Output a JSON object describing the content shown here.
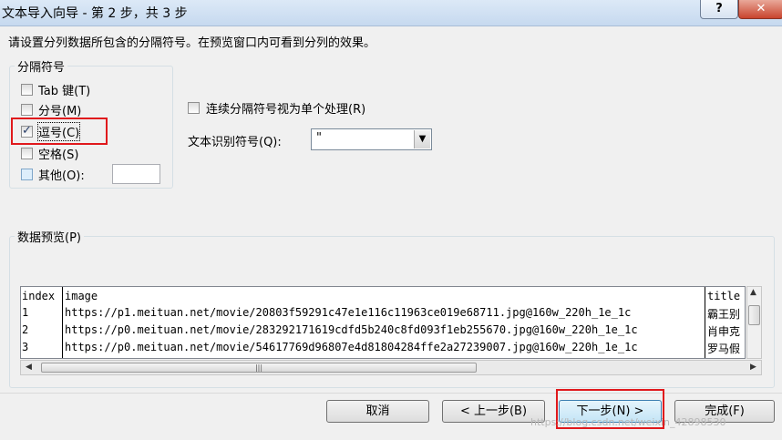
{
  "window": {
    "title": "文本导入向导 - 第 2 步，共 3 步",
    "help_label": "?",
    "close_label": "✕"
  },
  "instruction": "请设置分列数据所包含的分隔符号。在预览窗口内可看到分列的效果。",
  "delimiters": {
    "group_label": "分隔符号",
    "tab": {
      "label": "Tab 键(T)",
      "checked": false
    },
    "semicolon": {
      "label": "分号(M)",
      "checked": false
    },
    "comma": {
      "label": "逗号(C)",
      "checked": true
    },
    "space": {
      "label": "空格(S)",
      "checked": false
    },
    "other": {
      "label": "其他(O):",
      "checked": false,
      "value": ""
    }
  },
  "options": {
    "consecutive_label": "连续分隔符号视为单个处理(R)",
    "consecutive_checked": false,
    "text_qualifier_label": "文本识别符号(Q):",
    "text_qualifier_value": "\"",
    "dropdown_arrow": "▼"
  },
  "preview": {
    "group_label": "数据预览(P)",
    "columns": [
      "index",
      "image",
      "title"
    ],
    "rows": [
      [
        "1",
        "https://p1.meituan.net/movie/20803f59291c47e1e116c11963ce019e68711.jpg@160w_220h_1e_1c",
        "霸王别"
      ],
      [
        "2",
        "https://p0.meituan.net/movie/283292171619cdfd5b240c8fd093f1eb255670.jpg@160w_220h_1e_1c",
        "肖申克"
      ],
      [
        "3",
        "https://p0.meituan.net/movie/54617769d96807e4d81804284ffe2a27239007.jpg@160w_220h_1e_1c",
        "罗马假"
      ]
    ],
    "scroll_up": "▲",
    "scroll_left": "◀",
    "scroll_right": "▶",
    "thumb_grip": "|||"
  },
  "buttons": {
    "cancel": "取消",
    "back": "< 上一步(B)",
    "next": "下一步(N) >",
    "finish": "完成(F)"
  },
  "watermark": "https://blog.csdn.net/weixin_42898530",
  "colors": {
    "highlight_red": "#e0191c",
    "title_bar": "#c6d9ef"
  }
}
